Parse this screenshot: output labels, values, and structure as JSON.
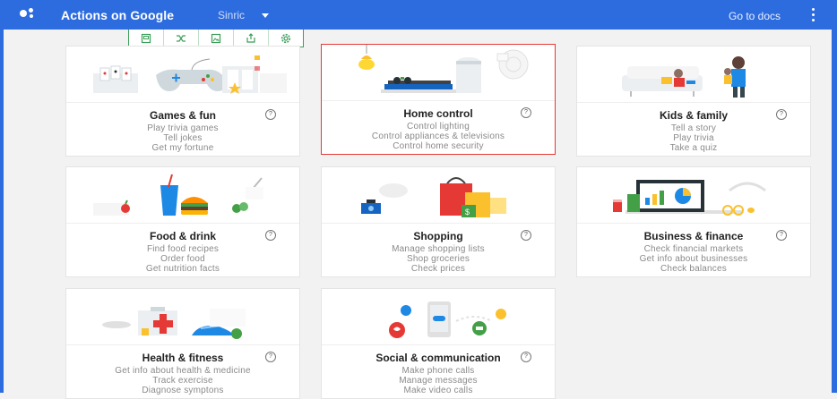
{
  "header": {
    "title": "Actions on Google",
    "project": "Sinric",
    "docs_link": "Go to docs",
    "colors": {
      "bar": "#2d6cdf"
    }
  },
  "toolbar": {
    "icons": [
      "save-icon",
      "shuffle-icon",
      "image-icon",
      "share-icon",
      "settings-icon"
    ]
  },
  "categories": [
    {
      "title": "Games & fun",
      "lines": [
        "Play trivia games",
        "Tell jokes",
        "Get my fortune"
      ]
    },
    {
      "title": "Home control",
      "lines": [
        "Control lighting",
        "Control appliances & televisions",
        "Control home security"
      ]
    },
    {
      "title": "Kids & family",
      "lines": [
        "Tell a story",
        "Play trivia",
        "Take a quiz"
      ]
    },
    {
      "title": "Food & drink",
      "lines": [
        "Find food recipes",
        "Order food",
        "Get nutrition facts"
      ]
    },
    {
      "title": "Shopping",
      "lines": [
        "Manage shopping lists",
        "Shop groceries",
        "Check prices"
      ]
    },
    {
      "title": "Business & finance",
      "lines": [
        "Check financial markets",
        "Get info about businesses",
        "Check balances"
      ]
    },
    {
      "title": "Health & fitness",
      "lines": [
        "Get info about health & medicine",
        "Track exercise",
        "Diagnose symptons"
      ]
    },
    {
      "title": "Social & communication",
      "lines": [
        "Make phone calls",
        "Manage messages",
        "Make video calls"
      ]
    }
  ],
  "help_glyph": "?"
}
